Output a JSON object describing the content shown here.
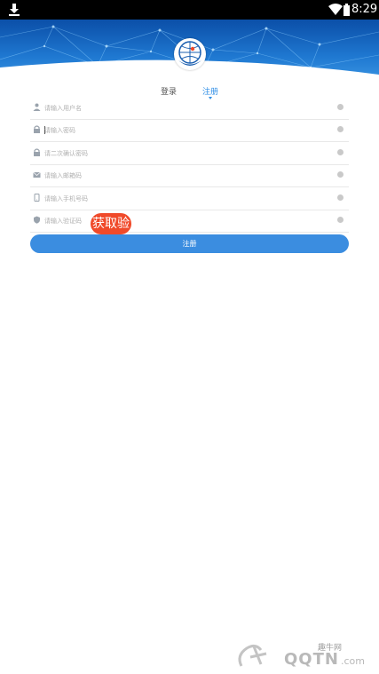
{
  "status_bar": {
    "time": "8:29",
    "download_icon": "download-icon",
    "wifi_icon": "wifi-icon",
    "battery_icon": "battery-icon"
  },
  "brand": {
    "logo_icon": "globe-hand-logo",
    "accent_color": "#2f8ee6",
    "banner_color": "#1f78d1"
  },
  "tabs": [
    {
      "label": "登录",
      "active": false
    },
    {
      "label": "注册",
      "active": true
    }
  ],
  "form": {
    "fields": [
      {
        "name": "username",
        "icon": "user-icon",
        "placeholder": "请输入用户名",
        "value": ""
      },
      {
        "name": "password",
        "icon": "lock-icon",
        "placeholder": "请输入密码",
        "value": ""
      },
      {
        "name": "confirm_password",
        "icon": "lock-icon",
        "placeholder": "请二次确认密码",
        "value": ""
      },
      {
        "name": "email",
        "icon": "mail-icon",
        "placeholder": "请输入邮箱码",
        "value": ""
      },
      {
        "name": "phone",
        "icon": "phone-icon",
        "placeholder": "请输入手机号码",
        "value": ""
      },
      {
        "name": "verification_code",
        "icon": "shield-icon",
        "placeholder": "请输入验证码",
        "value": ""
      }
    ],
    "get_code_label": "获取验",
    "get_code_color": "#f04a2a",
    "submit_label": "注册"
  },
  "watermark": {
    "small_text": "趣牛网",
    "big_text": "QQTN",
    "suffix": ".com"
  }
}
